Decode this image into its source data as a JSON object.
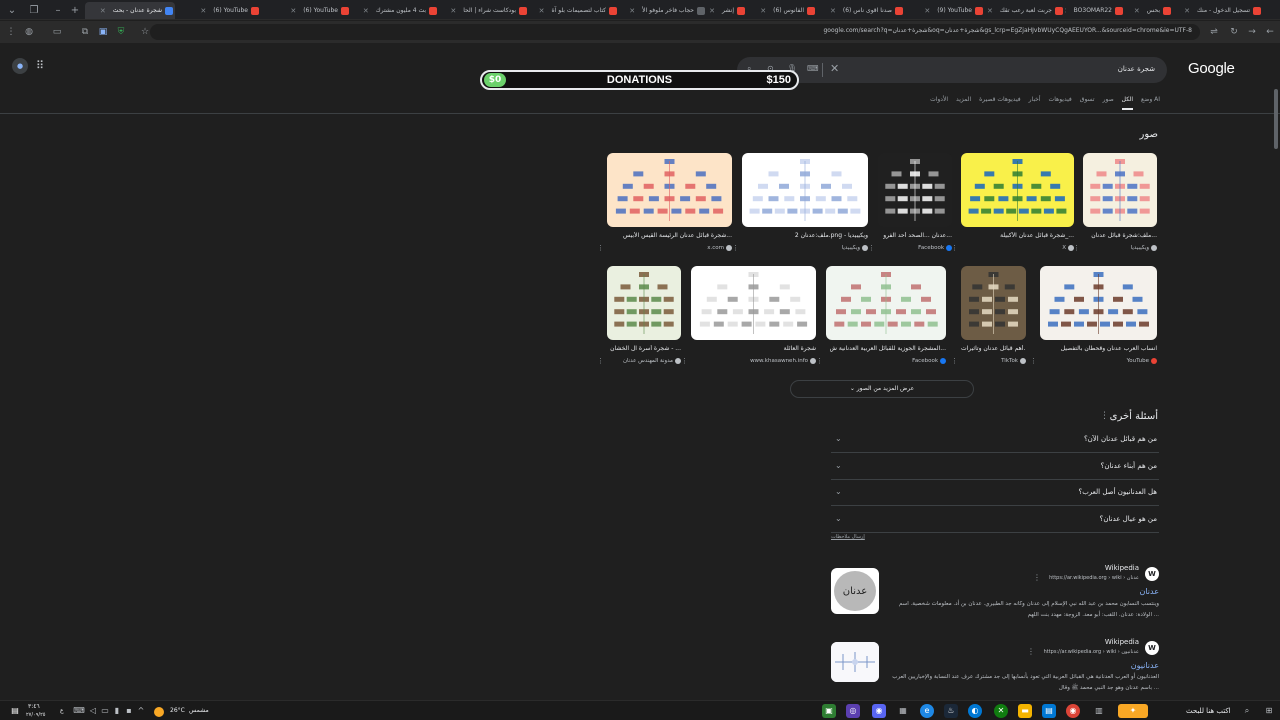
{
  "window_controls": {
    "minimize": "–",
    "restore": "❐",
    "close": "✕"
  },
  "tabs": [
    {
      "label": "تسجيل الدخول - منك",
      "color": "#ea4335"
    },
    {
      "label": "بحس",
      "color": "#ea4335"
    },
    {
      "label": "BO3OMAR22",
      "color": "#ea4335"
    },
    {
      "label": "جربت لعبة رعب تقك",
      "color": "#ea4335"
    },
    {
      "label": "(9) YouTube",
      "color": "#ea4335"
    },
    {
      "label": "(6) صدنا اقوى ناس",
      "color": "#ea4335"
    },
    {
      "label": "(6) الفانوس",
      "color": "#ea4335"
    },
    {
      "label": "إنشر",
      "color": "#ea4335"
    },
    {
      "label": "حجاب فاخر ملوفو الأ",
      "color": "#5f6368"
    },
    {
      "label": "كتاب لتصميمات بلو آة",
      "color": "#ea4335"
    },
    {
      "label": "بودكاست شراء | الحا",
      "color": "#ea4335"
    },
    {
      "label": "بث 4 مليون مشترك",
      "color": "#ea4335"
    },
    {
      "label": "(6) YouTube",
      "color": "#ea4335"
    },
    {
      "label": "(6) YouTube",
      "color": "#ea4335"
    },
    {
      "label": "شجرة عدنان - بحث",
      "color": "#4285f4"
    }
  ],
  "new_tab": "+",
  "address_bar": {
    "url": "google.com/search?q=شجرة+عدنان&oq=شجرة+عدنان&gs_lcrp=EgZjaHJvbWUyCQgAEEUYOR...&sourceid=chrome&ie=UTF-8"
  },
  "logo": "Google",
  "search": {
    "query": "شجرة عدنان"
  },
  "donations": {
    "left": "$0",
    "title": "DONATIONS",
    "right": "$150"
  },
  "filters": [
    "وضع AI",
    "الكل",
    "صور",
    "تسوق",
    "فيديوهات",
    "أخبار",
    "فيديوهات قصيرة",
    "المزيد",
    "الأدوات"
  ],
  "images_title": "صور",
  "images": [
    {
      "caption": "ملف:شجرة قبائل عدنان...",
      "source": "ويكيبيديا",
      "c1": "#f5f0e0",
      "c2": "#4a72c4",
      "c3": "#e88"
    },
    {
      "caption": "شجرة قبائل عدنان الأكبيلة_...",
      "source": "X",
      "c1": "#f9f04a",
      "c2": "#2e7d32",
      "c3": "#1565c0"
    },
    {
      "caption": "عدنان ...الصحد أحد الفرو...",
      "source": "Facebook",
      "c1": "#202020",
      "c2": "#ffffff",
      "c3": "#aaaaaa"
    },
    {
      "caption": "ملف:عدنان 2.png - ويكيبيديا",
      "source": "ويكيبيديا",
      "c1": "#ffffff",
      "c2": "#8fa8d8",
      "c3": "#c8d4ee"
    },
    {
      "caption": "شجرة قبائل عدنان الرئيسة القيس الأبيس...",
      "source": "x.com",
      "c1": "#fde4c8",
      "c2": "#e06060",
      "c3": "#4a6fc0"
    },
    {
      "caption": "انساب العرب عدنان وقحطان بالتفصيل",
      "source": "YouTube",
      "c1": "#f4f1ec",
      "c2": "#6b3b2a",
      "c3": "#3a6fc0"
    },
    {
      "caption": "أهم قبائل عدنان وتاثيرات...",
      "source": "TikTok",
      "c1": "#6d5c45",
      "c2": "#e8dcc4",
      "c3": "#333"
    },
    {
      "caption": "المشجرة الجوزية للقبائل العربية العدنانية ش...",
      "source": "Facebook",
      "c1": "#f0f5f0",
      "c2": "#8fbf8f",
      "c3": "#c07070"
    },
    {
      "caption": "شجرة العائلة",
      "source": "www.khasawneh.info",
      "c1": "#ffffff",
      "c2": "#999999",
      "c3": "#dddddd"
    },
    {
      "caption": "شجرة أسرة آل الخشان - ...",
      "source": "مدونة المهندس عدنان",
      "c1": "#eaf0e0",
      "c2": "#5a8a4a",
      "c3": "#7a5a3a"
    }
  ],
  "more_images": "عرض المزيد من الصور",
  "paa_title": "أسئلة أخرى",
  "paa": [
    "من هم قبائل عدنان الآن؟",
    "من هم أبناء عدنان؟",
    "هل العدنانيون أصل العرب؟",
    "من هو عيال عدنان؟"
  ],
  "feedback": "إرسال ملاحظات",
  "results": [
    {
      "site": "Wikipedia",
      "url": "https://ar.wikipedia.org › wiki › عدنان",
      "title": "عدنان",
      "snippet": "وينتسب النسابون محمد بن عبد الله نبي الإسلام إلى عدنان وكانه جد الطبيري. عدنان بن أد. معلومات شخصية. اسم الولادة: عدنان. اللقب: أبو معد. الزوجة: مهدد بنت اللهم ...",
      "thumb_text": "عدنان"
    },
    {
      "site": "Wikipedia",
      "url": "https://ar.wikipedia.org › wiki › عدنانيون",
      "title": "عدنانيون",
      "snippet": "العدنانيون أو العرب العدنانية هي القبائل العربية التي تعود بأنسابها إلى جد مشترك عرف عند النسابة والإخباريين العرب باسم عدنان وهو جد النبي محمد ﷺ وقال ..."
    }
  ],
  "taskbar": {
    "search_placeholder": "اكتب هنا للبحث",
    "weather_temp": "26°C",
    "weather_desc": "مشمس",
    "time": "٣:٤٦",
    "date": "٢٧/٠٩/٢٥",
    "lang": "ع"
  }
}
